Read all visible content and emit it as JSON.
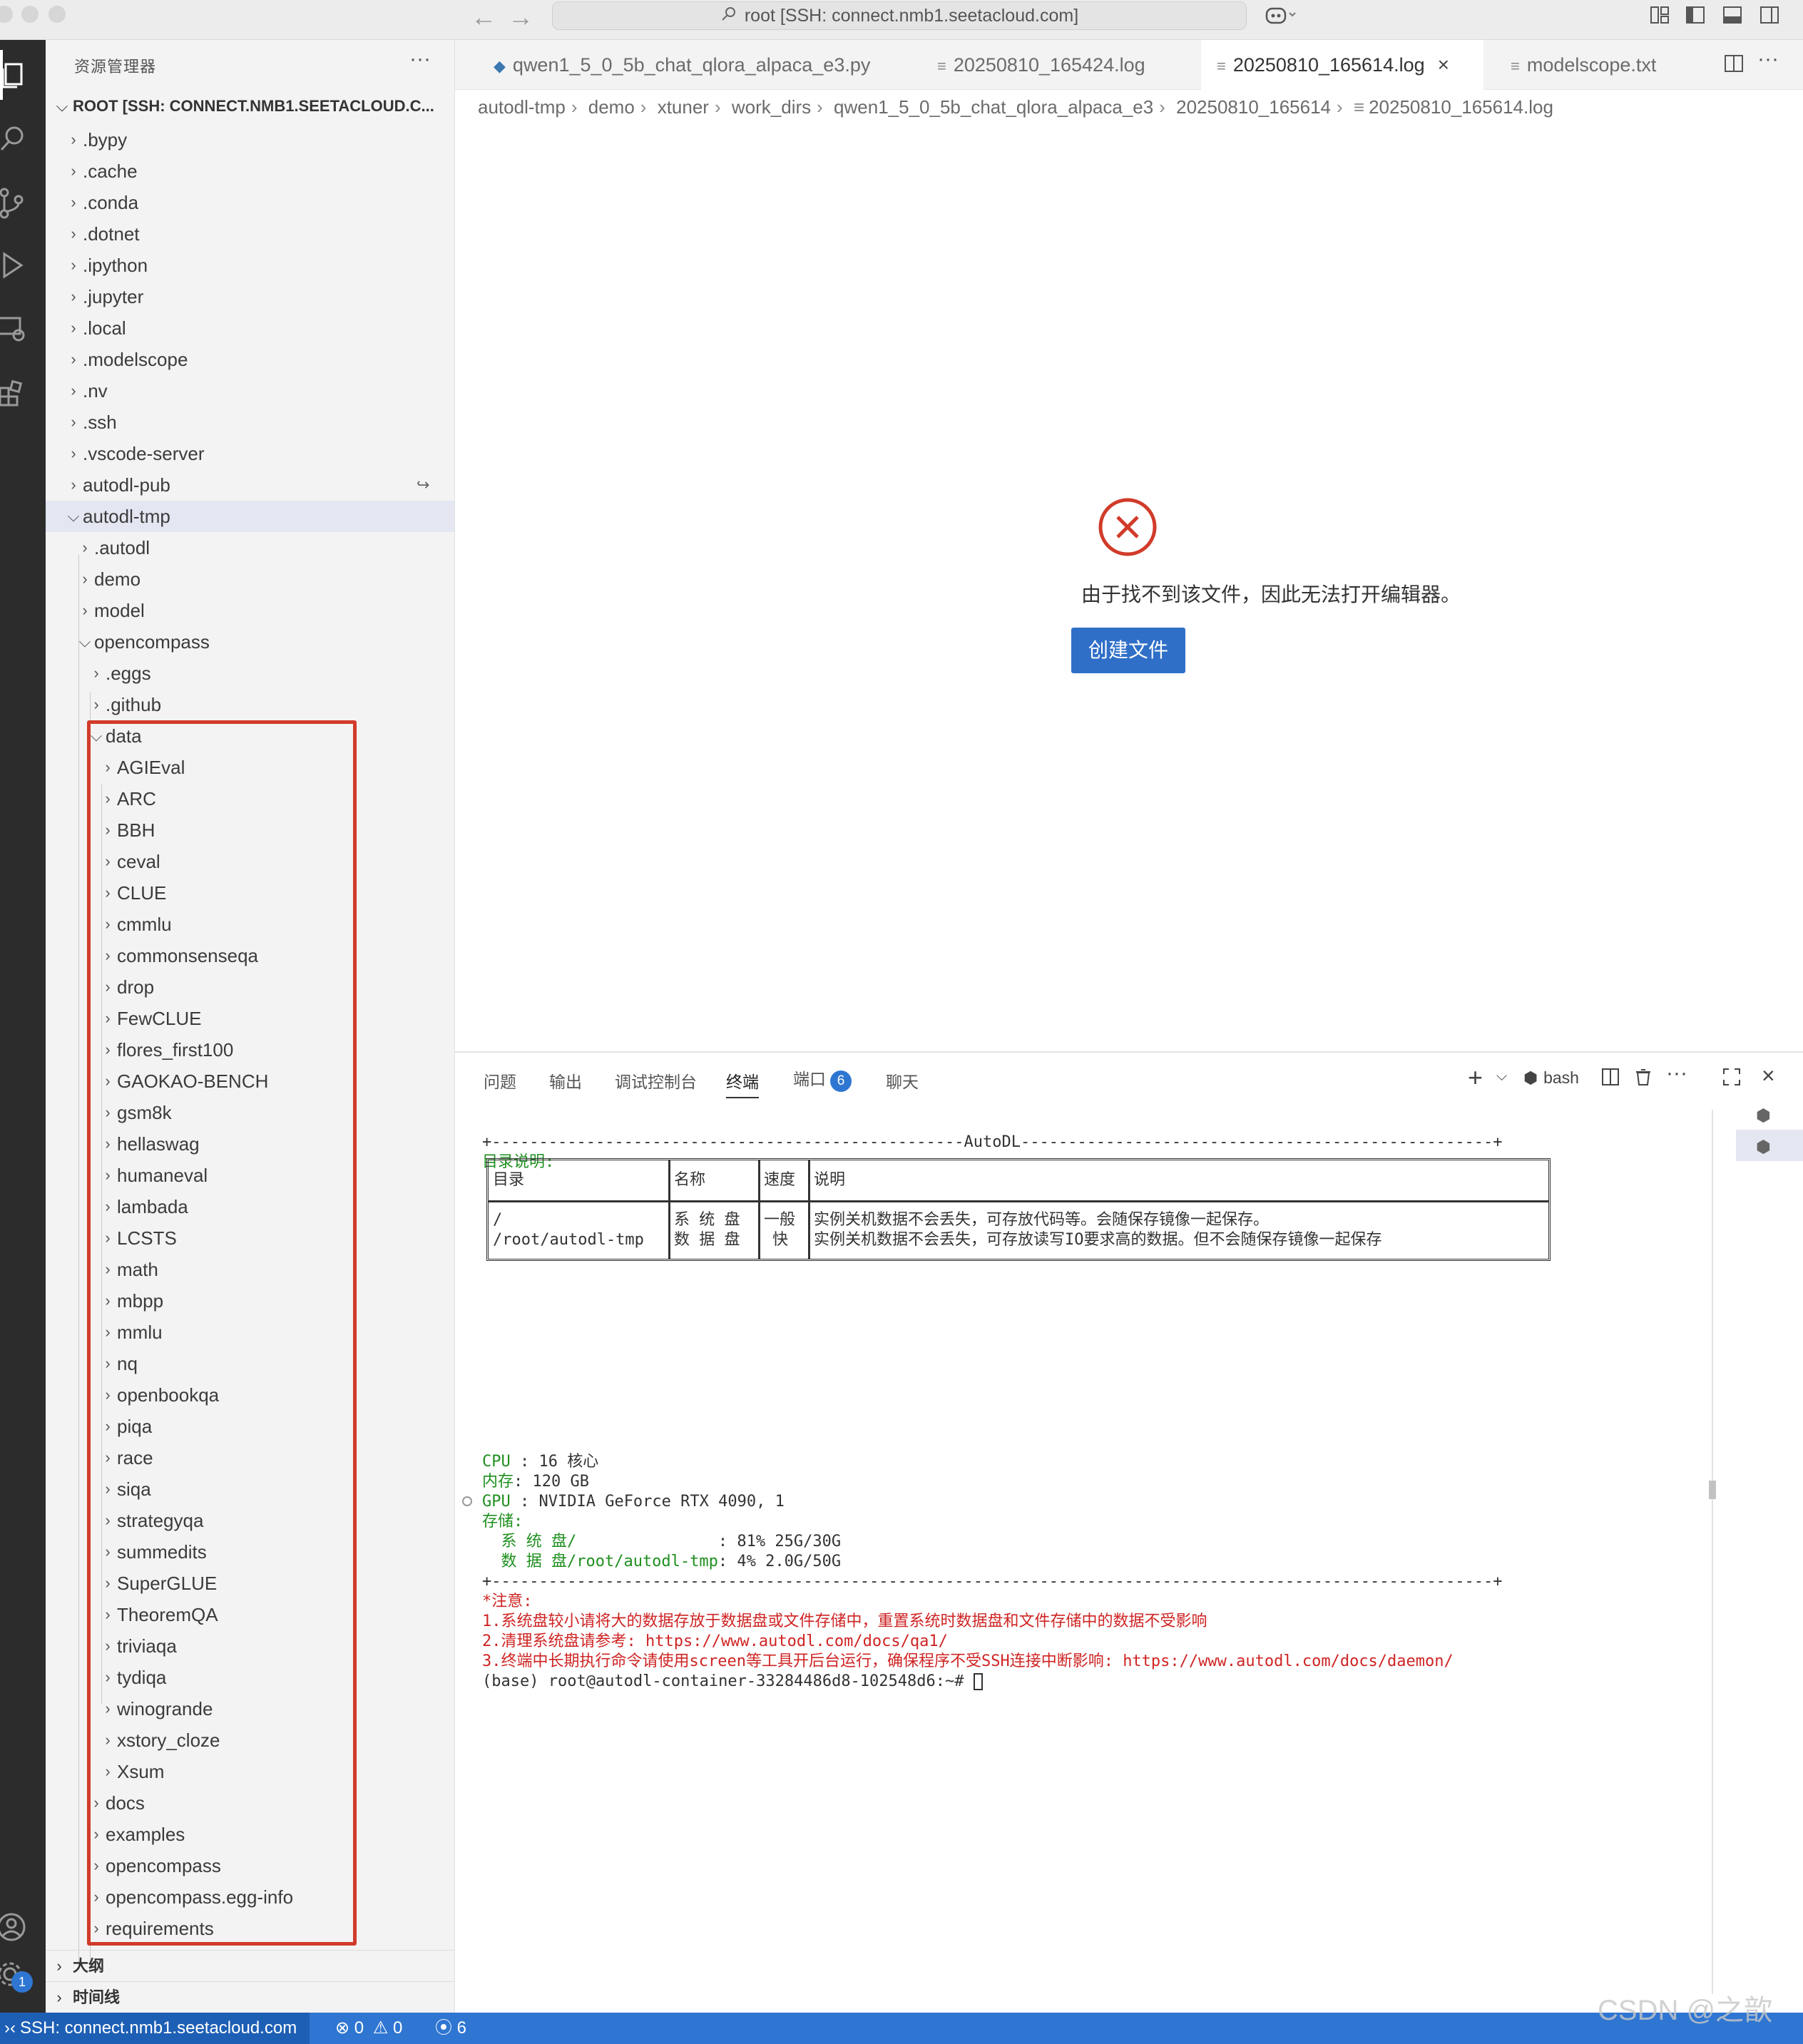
{
  "window": {
    "search_text": "root [SSH: connect.nmb1.seetacloud.com]"
  },
  "sidebar": {
    "title": "资源管理器",
    "root": "ROOT [SSH: CONNECT.NMB1.SEETACLOUD.C...",
    "top_items": [
      ".bypy",
      ".cache",
      ".conda",
      ".dotnet",
      ".ipython",
      ".jupyter",
      ".local",
      ".modelscope",
      ".nv",
      ".ssh",
      ".vscode-server",
      "autodl-pub",
      "autodl-tmp"
    ],
    "autodl_tmp_items": [
      ".autodl",
      "demo",
      "model",
      "opencompass"
    ],
    "opencompass_items": [
      ".eggs",
      ".github",
      "data"
    ],
    "data_items": [
      "AGIEval",
      "ARC",
      "BBH",
      "ceval",
      "CLUE",
      "cmmlu",
      "commonsenseqa",
      "drop",
      "FewCLUE",
      "flores_first100",
      "GAOKAO-BENCH",
      "gsm8k",
      "hellaswag",
      "humaneval",
      "lambada",
      "LCSTS",
      "math",
      "mbpp",
      "mmlu",
      "nq",
      "openbookqa",
      "piqa",
      "race",
      "siqa",
      "strategyqa",
      "summedits",
      "SuperGLUE",
      "TheoremQA",
      "triviaqa",
      "tydiqa",
      "winogrande",
      "xstory_cloze",
      "Xsum"
    ],
    "opencompass_rest": [
      "docs",
      "examples",
      "opencompass",
      "opencompass.egg-info",
      "requirements"
    ],
    "outline": "大纲",
    "timeline": "时间线"
  },
  "tabs": [
    {
      "label": "qwen1_5_0_5b_chat_qlora_alpaca_e3.py",
      "icon": "python-icon"
    },
    {
      "label": "20250810_165424.log",
      "icon": "file-lines-icon"
    },
    {
      "label": "20250810_165614.log",
      "icon": "file-lines-icon"
    },
    {
      "label": "modelscope.txt",
      "icon": "file-lines-icon"
    }
  ],
  "breadcrumb": [
    "autodl-tmp",
    "demo",
    "xtuner",
    "work_dirs",
    "qwen1_5_0_5b_chat_qlora_alpaca_e3",
    "20250810_165614",
    "20250810_165614.log"
  ],
  "editor": {
    "error_message": "由于找不到该文件，因此无法打开编辑器。",
    "create_button": "创建文件"
  },
  "panel": {
    "tabs": [
      "问题",
      "输出",
      "调试控制台",
      "终端",
      "端口",
      "聊天"
    ],
    "ports_count": "6",
    "shell": "bash"
  },
  "terminal": {
    "border_top": "+--------------------------------------------------AutoDL--------------------------------------------------+",
    "dir_title": "目录说明:",
    "table": {
      "headers": [
        "目录",
        "名称",
        "速度",
        "说明"
      ],
      "dir_lines": [
        "/",
        "/root/autodl-tmp"
      ],
      "name_lines": [
        "系 统 盘",
        "数 据 盘"
      ],
      "speed_lines": [
        "一般",
        "快"
      ],
      "desc_lines": [
        "实例关机数据不会丢失，可存放代码等。会随保存镜像一起保存。",
        "实例关机数据不会丢失，可存放读写IO要求高的数据。但不会随保存镜像一起保存"
      ]
    },
    "cpu_label": "CPU",
    "cpu_value": " : 16 核心",
    "mem_label": "内存",
    "mem_value": ": 120 GB",
    "gpu_label": "GPU",
    "gpu_value": " : NVIDIA GeForce RTX 4090, 1",
    "storage_label": "存储:",
    "sys_disk_label": "  系 统 盘/               ",
    "sys_disk_value": ": 81% 25G/30G",
    "data_disk_label": "  数 据 盘/root/autodl-tmp",
    "data_disk_value": ": 4% 2.0G/50G",
    "border_bottom": "+----------------------------------------------------------------------------------------------------------+",
    "notice_title": "*注意:",
    "notice_1": "1.系统盘较小请将大的数据存放于数据盘或文件存储中，重置系统时数据盘和文件存储中的数据不受影响",
    "notice_2": "2.清理系统盘请参考: https://www.autodl.com/docs/qa1/",
    "notice_3": "3.终端中长期执行命令请使用screen等工具开后台运行，确保程序不受SSH连接中断影响: https://www.autodl.com/docs/daemon/",
    "prompt": "(base) root@autodl-container-33284486d8-102548d6:~# "
  },
  "statusbar": {
    "remote": "SSH: connect.nmb1.seetacloud.com",
    "errors": "0",
    "warnings": "0",
    "ports": "6"
  },
  "account_badge": "1",
  "watermark": "CSDN @之歆",
  "colors": {
    "accent": "#2f76d2",
    "error_red": "#d13b2a",
    "highlight_box": "#d13b2a",
    "terminal_green": "#1f8f1f",
    "terminal_red": "#cf2424"
  }
}
